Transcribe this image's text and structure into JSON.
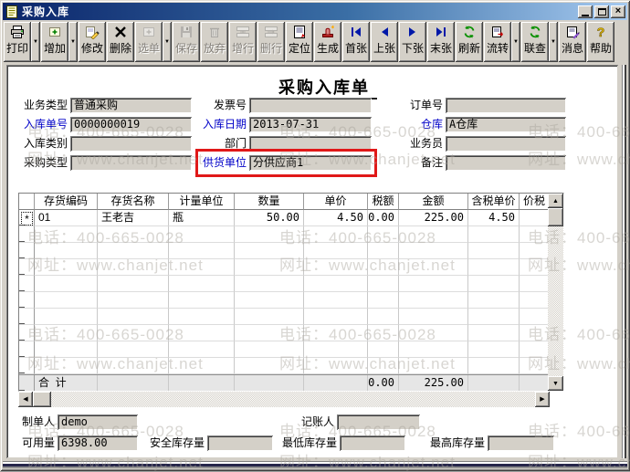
{
  "window": {
    "title": "采购入库"
  },
  "icons": {
    "close": "×",
    "dropdown": "▼",
    "up": "▲",
    "down": "▼",
    "left": "◀",
    "right": "▶"
  },
  "toolbar": {
    "buttons": [
      {
        "name": "print",
        "label": "打印",
        "icon": "printer-icon",
        "enabled": true,
        "dropdown": true
      },
      {
        "name": "add",
        "label": "增加",
        "icon": "add-icon",
        "enabled": true,
        "dropdown": true
      },
      {
        "name": "modify",
        "label": "修改",
        "icon": "edit-icon",
        "enabled": true,
        "dropdown": false
      },
      {
        "name": "delete",
        "label": "删除",
        "icon": "delete-icon",
        "enabled": true,
        "dropdown": false
      },
      {
        "name": "select-order",
        "label": "选单",
        "icon": "select-order-icon",
        "enabled": false,
        "dropdown": true
      },
      {
        "name": "save",
        "label": "保存",
        "icon": "save-icon",
        "enabled": false,
        "dropdown": false
      },
      {
        "name": "discard",
        "label": "放弃",
        "icon": "discard-icon",
        "enabled": false,
        "dropdown": false
      },
      {
        "name": "add-row",
        "label": "增行",
        "icon": "add-row-icon",
        "enabled": false,
        "dropdown": false
      },
      {
        "name": "delete-row",
        "label": "删行",
        "icon": "delete-row-icon",
        "enabled": false,
        "dropdown": false
      },
      {
        "name": "locate",
        "label": "定位",
        "icon": "locate-icon",
        "enabled": true,
        "dropdown": false
      },
      {
        "name": "generate",
        "label": "生成",
        "icon": "generate-icon",
        "enabled": true,
        "dropdown": false
      },
      {
        "name": "first",
        "label": "首张",
        "icon": "first-record-icon",
        "enabled": true,
        "dropdown": false
      },
      {
        "name": "prev",
        "label": "上张",
        "icon": "prev-record-icon",
        "enabled": true,
        "dropdown": false
      },
      {
        "name": "next",
        "label": "下张",
        "icon": "next-record-icon",
        "enabled": true,
        "dropdown": false
      },
      {
        "name": "last",
        "label": "末张",
        "icon": "last-record-icon",
        "enabled": true,
        "dropdown": false
      },
      {
        "name": "refresh",
        "label": "刷新",
        "icon": "refresh-icon",
        "enabled": true,
        "dropdown": false
      },
      {
        "name": "flow",
        "label": "流转",
        "icon": "flow-icon",
        "enabled": true,
        "dropdown": true
      },
      {
        "name": "linked-query",
        "label": "联查",
        "icon": "linked-query-icon",
        "enabled": true,
        "dropdown": true
      },
      {
        "name": "message",
        "label": "消息",
        "icon": "message-icon",
        "enabled": true,
        "dropdown": false
      },
      {
        "name": "help",
        "label": "帮助",
        "icon": "help-icon",
        "enabled": true,
        "dropdown": false
      }
    ]
  },
  "form": {
    "title": "采购入库单",
    "fields": [
      {
        "name": "business-type",
        "label": "业务类型",
        "value": "普通采购",
        "emphasis": false,
        "highlighted": false
      },
      {
        "name": "invoice-no",
        "label": "发票号",
        "value": "",
        "emphasis": false,
        "highlighted": false
      },
      {
        "name": "order-no",
        "label": "订单号",
        "value": "",
        "emphasis": false,
        "highlighted": false
      },
      {
        "name": "entry-no",
        "label": "入库单号",
        "value": "0000000019",
        "emphasis": true,
        "highlighted": false
      },
      {
        "name": "entry-date",
        "label": "入库日期",
        "value": "2013-07-31",
        "emphasis": true,
        "highlighted": false
      },
      {
        "name": "warehouse",
        "label": "仓库",
        "value": "A仓库",
        "emphasis": true,
        "highlighted": false
      },
      {
        "name": "entry-category",
        "label": "入库类别",
        "value": "",
        "emphasis": false,
        "highlighted": false
      },
      {
        "name": "department",
        "label": "部门",
        "value": "",
        "emphasis": false,
        "highlighted": false
      },
      {
        "name": "salesperson",
        "label": "业务员",
        "value": "",
        "emphasis": false,
        "highlighted": false
      },
      {
        "name": "purchase-type",
        "label": "采购类型",
        "value": "",
        "emphasis": false,
        "highlighted": false
      },
      {
        "name": "supplier",
        "label": "供货单位",
        "value": "分供应商1",
        "emphasis": true,
        "highlighted": true
      },
      {
        "name": "remarks",
        "label": "备注",
        "value": "",
        "emphasis": false,
        "highlighted": false
      }
    ]
  },
  "table": {
    "row_marker": "*",
    "columns": [
      "",
      "存货编码",
      "存货名称",
      "计量单位",
      "数量",
      "单价",
      "税额",
      "金额",
      "含税单价",
      "价税"
    ],
    "rows": [
      [
        "",
        "01",
        "王老吉",
        "瓶",
        "50.00",
        "4.50",
        "0.00",
        "225.00",
        "4.50",
        ""
      ]
    ],
    "empty_row_count": 9,
    "total": {
      "label": "合  计",
      "tax": "0.00",
      "amount": "225.00"
    }
  },
  "footer": {
    "fields": [
      {
        "name": "creator",
        "label": "制单人",
        "value": "demo"
      },
      {
        "name": "bookkeeper",
        "label": "记账人",
        "value": ""
      },
      {
        "name": "available-qty",
        "label": "可用量",
        "value": "6398.00"
      },
      {
        "name": "safety-stock",
        "label": "安全库存量",
        "value": ""
      },
      {
        "name": "min-stock",
        "label": "最低库存量",
        "value": ""
      },
      {
        "name": "max-stock",
        "label": "最高库存量",
        "value": ""
      }
    ]
  },
  "watermark": {
    "phone": "电话：400-665-0028",
    "site": "网址：www.chanjet.net"
  },
  "colors": {
    "chrome": "#d4d0c8",
    "titlebar_left": "#0a246a",
    "titlebar_right": "#a6caf0",
    "label_blue": "#0000c8",
    "highlight_red": "#e01818",
    "watermark_gray": "#a8a39b"
  }
}
